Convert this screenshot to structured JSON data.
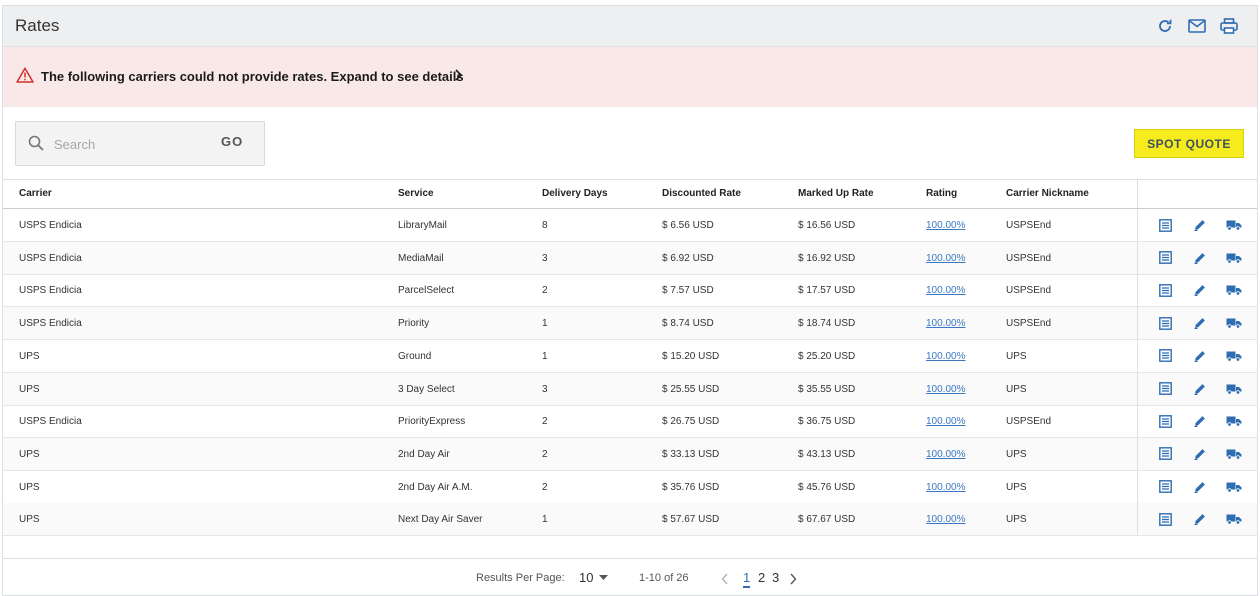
{
  "header": {
    "title": "Rates",
    "icons": [
      "refresh-icon",
      "mail-icon",
      "print-icon"
    ]
  },
  "alert": {
    "text": "The following carriers could not provide rates. Expand to see details"
  },
  "search": {
    "placeholder": "Search",
    "value": "",
    "go_label": "GO"
  },
  "spot_quote_label": "SPOT QUOTE",
  "table": {
    "columns": {
      "carrier": "Carrier",
      "service": "Service",
      "days": "Delivery Days",
      "discounted": "Discounted Rate",
      "marked": "Marked Up Rate",
      "rating": "Rating",
      "nickname": "Carrier Nickname"
    },
    "rows": [
      {
        "carrier": "USPS Endicia",
        "service": "LibraryMail",
        "days": "8",
        "discounted": "$ 6.56 USD",
        "marked": "$ 16.56 USD",
        "rating": "100.00%",
        "nickname": "USPSEnd"
      },
      {
        "carrier": "USPS Endicia",
        "service": "MediaMail",
        "days": "3",
        "discounted": "$ 6.92 USD",
        "marked": "$ 16.92 USD",
        "rating": "100.00%",
        "nickname": "USPSEnd"
      },
      {
        "carrier": "USPS Endicia",
        "service": "ParcelSelect",
        "days": "2",
        "discounted": "$ 7.57 USD",
        "marked": "$ 17.57 USD",
        "rating": "100.00%",
        "nickname": "USPSEnd"
      },
      {
        "carrier": "USPS Endicia",
        "service": "Priority",
        "days": "1",
        "discounted": "$ 8.74 USD",
        "marked": "$ 18.74 USD",
        "rating": "100.00%",
        "nickname": "USPSEnd"
      },
      {
        "carrier": "UPS",
        "service": "Ground",
        "days": "1",
        "discounted": "$ 15.20 USD",
        "marked": "$ 25.20 USD",
        "rating": "100.00%",
        "nickname": "UPS"
      },
      {
        "carrier": "UPS",
        "service": "3 Day Select",
        "days": "3",
        "discounted": "$ 25.55 USD",
        "marked": "$ 35.55 USD",
        "rating": "100.00%",
        "nickname": "UPS"
      },
      {
        "carrier": "USPS Endicia",
        "service": "PriorityExpress",
        "days": "2",
        "discounted": "$ 26.75 USD",
        "marked": "$ 36.75 USD",
        "rating": "100.00%",
        "nickname": "USPSEnd"
      },
      {
        "carrier": "UPS",
        "service": "2nd Day Air",
        "days": "2",
        "discounted": "$ 33.13 USD",
        "marked": "$ 43.13 USD",
        "rating": "100.00%",
        "nickname": "UPS"
      },
      {
        "carrier": "UPS",
        "service": "2nd Day Air A.M.",
        "days": "2",
        "discounted": "$ 35.76 USD",
        "marked": "$ 45.76 USD",
        "rating": "100.00%",
        "nickname": "UPS"
      },
      {
        "carrier": "UPS",
        "service": "Next Day Air Saver",
        "days": "1",
        "discounted": "$ 57.67 USD",
        "marked": "$ 67.67 USD",
        "rating": "100.00%",
        "nickname": "UPS"
      }
    ],
    "row_actions": [
      "details-icon",
      "edit-icon",
      "truck-icon"
    ]
  },
  "pagination": {
    "per_page_label": "Results Per Page:",
    "per_page_value": "10",
    "range_text": "1-10 of 26",
    "pages": [
      "1",
      "2",
      "3"
    ],
    "current_page": "1"
  },
  "colors": {
    "accent_blue": "#2f6db3",
    "alert_bg": "#f8e8e8",
    "alert_icon": "#d0312d",
    "spot_quote_bg": "#f6ec1d"
  }
}
